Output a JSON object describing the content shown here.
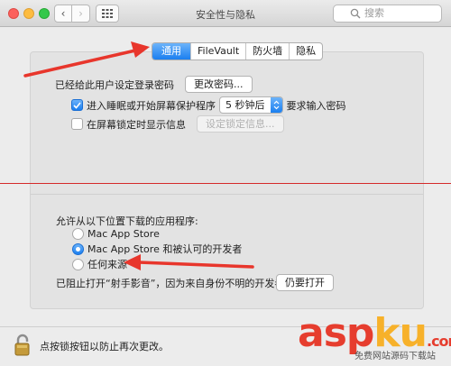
{
  "window": {
    "title": "安全性与隐私"
  },
  "search": {
    "placeholder": "搜索"
  },
  "tabs": [
    {
      "label": "通用",
      "active": true
    },
    {
      "label": "FileVault",
      "active": false
    },
    {
      "label": "防火墙",
      "active": false
    },
    {
      "label": "隐私",
      "active": false
    }
  ],
  "general": {
    "password_text": "已经给此用户设定登录密码",
    "change_password_button": "更改密码...",
    "sleep_checkbox_label": "进入睡眠或开始屏幕保护程序",
    "sleep_checkbox_checked": true,
    "sleep_delay_value": "5 秒钟后",
    "sleep_suffix": "要求输入密码",
    "lock_message_label": "在屏幕锁定时显示信息",
    "lock_message_checked": false,
    "set_lock_message_button": "设定锁定信息..."
  },
  "downloads": {
    "heading": "允许从以下位置下载的应用程序:",
    "options": [
      {
        "label": "Mac App Store",
        "selected": false
      },
      {
        "label": "Mac App Store 和被认可的开发者",
        "selected": true
      },
      {
        "label": "任何来源",
        "selected": false
      }
    ],
    "blocked_text": "已阻止打开“射手影音”，因为来自身份不明的开发者。",
    "open_anyway_button": "仍要打开"
  },
  "footer": {
    "lock_text": "点按锁按钮以防止再次更改。"
  },
  "watermark": {
    "brand_a": "asp",
    "brand_b": "ku",
    "brand_tld": ".com",
    "sub": "免费网站源码下载站"
  },
  "colors": {
    "accent": "#1b7ff0",
    "annotation": "#e8362c"
  }
}
